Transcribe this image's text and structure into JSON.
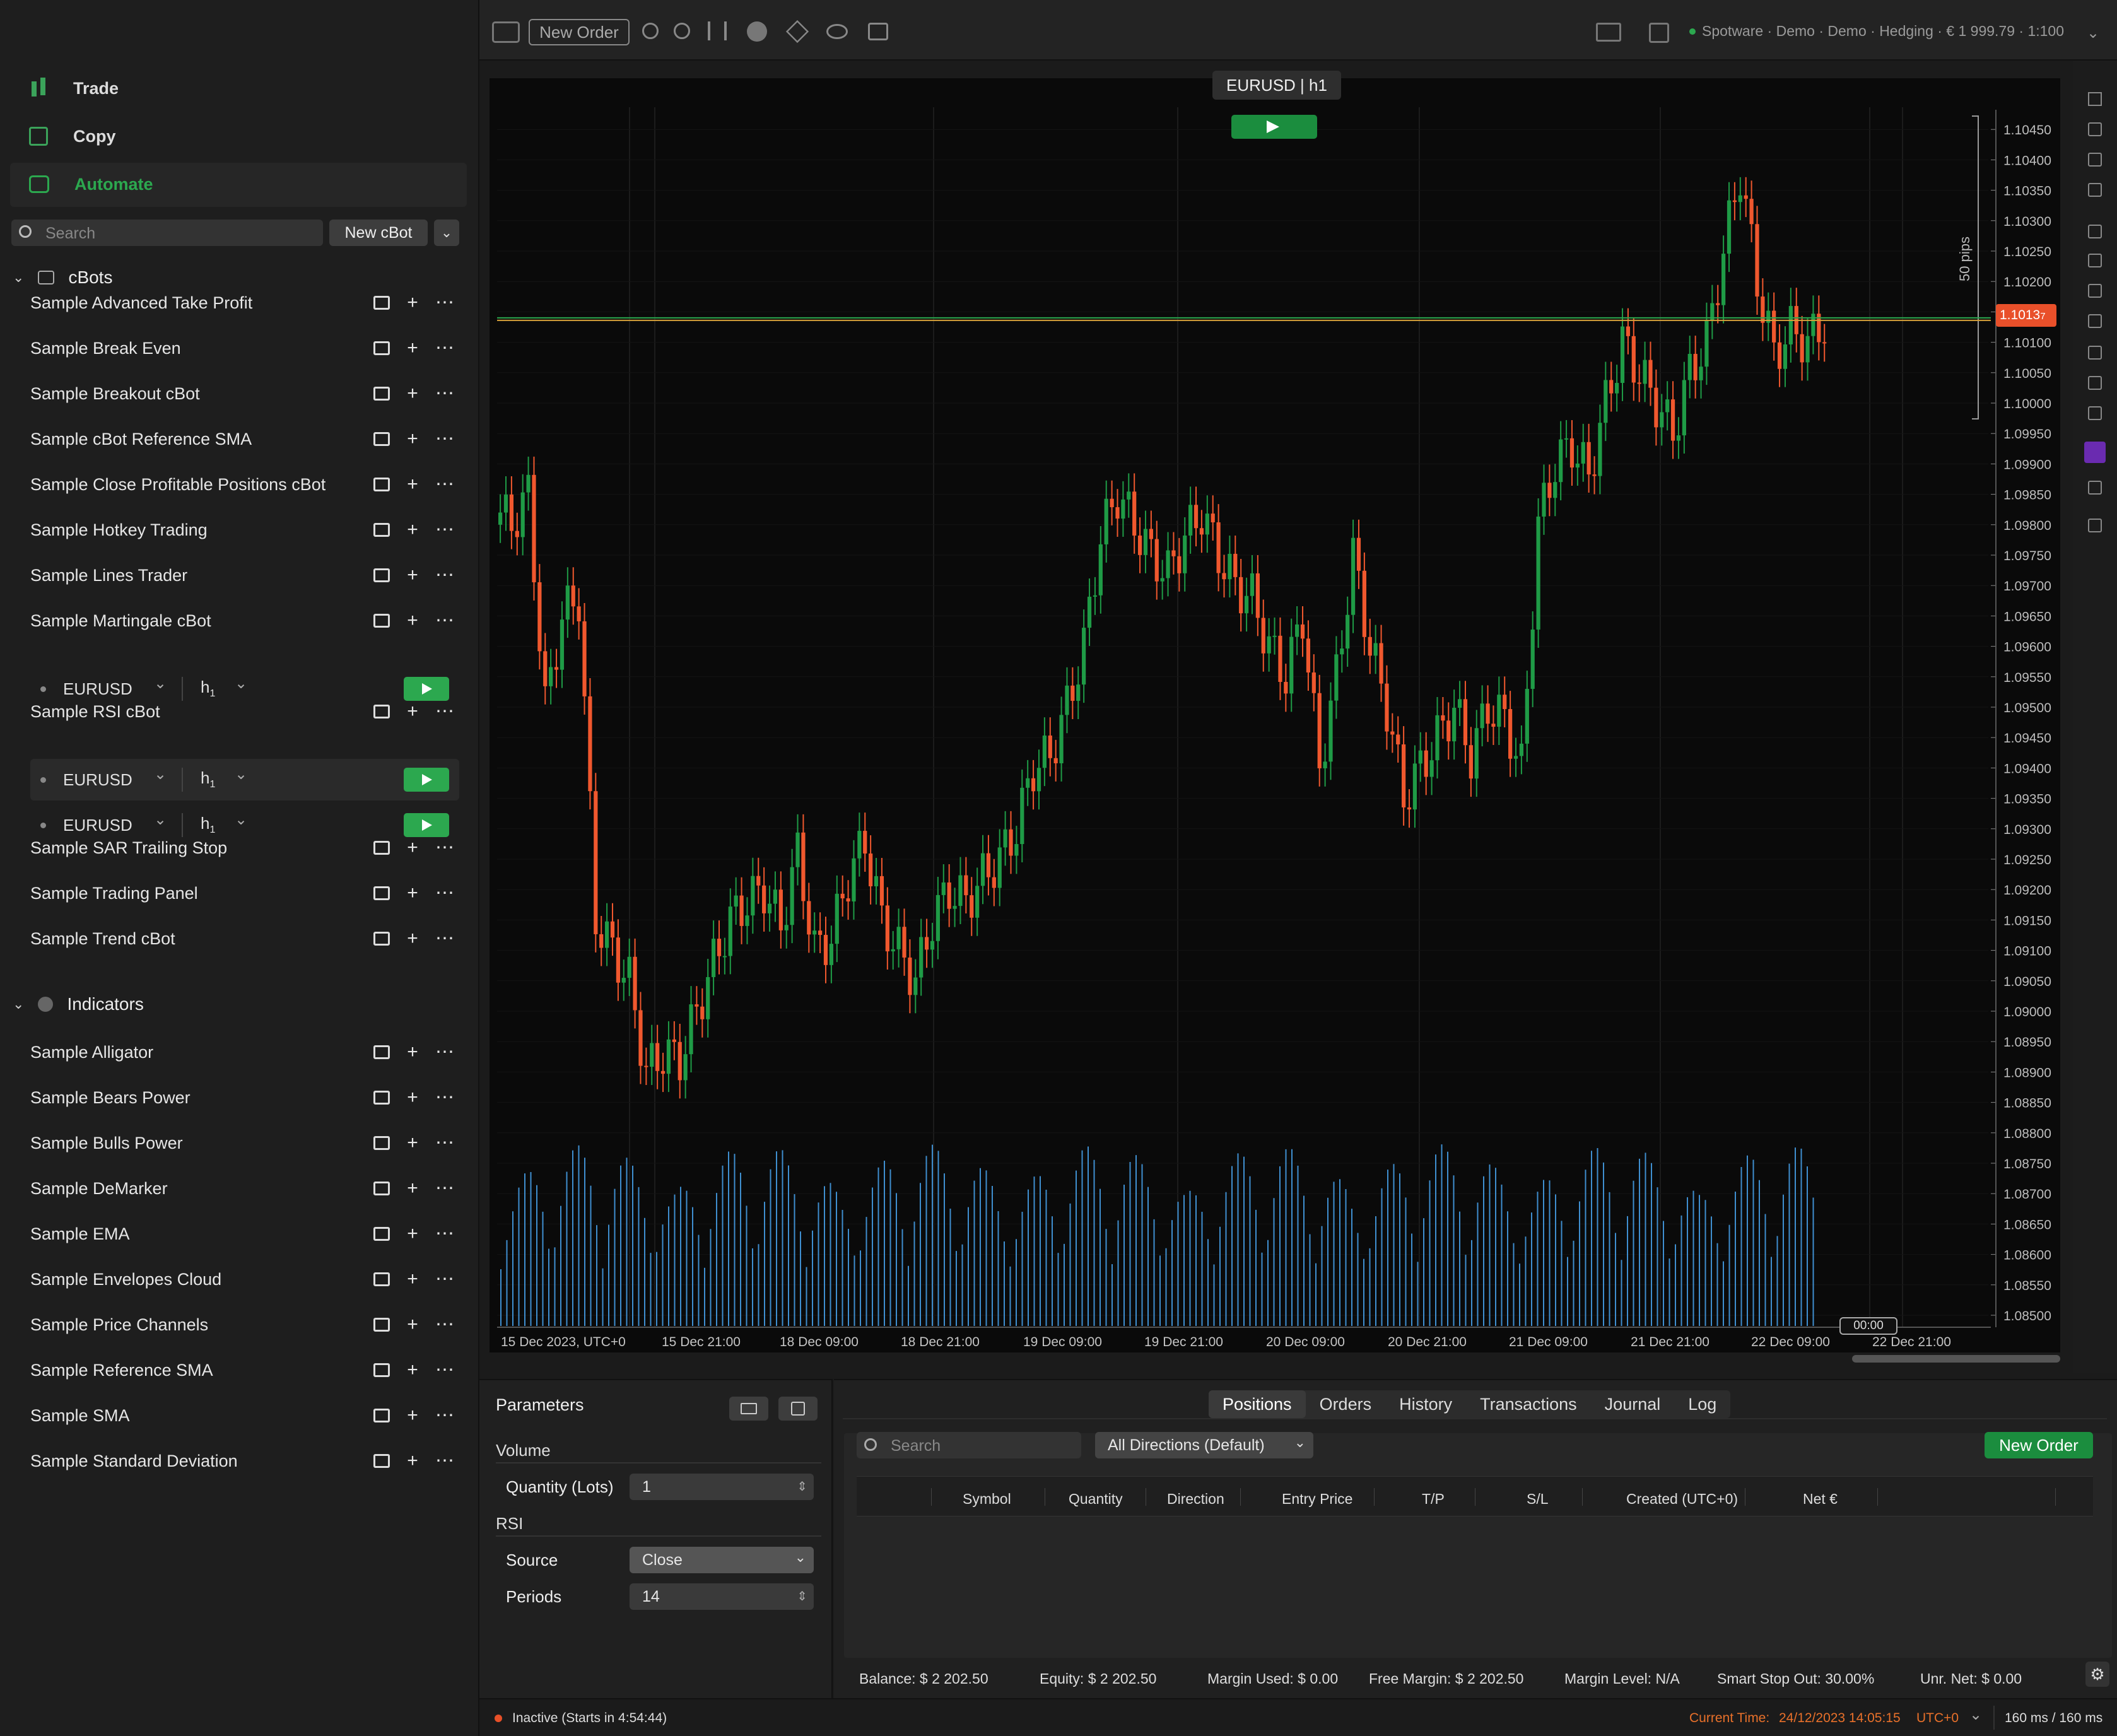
{
  "nav": [
    {
      "label": "Trade",
      "active": false
    },
    {
      "label": "Copy",
      "active": false
    },
    {
      "label": "Automate",
      "active": true
    }
  ],
  "sidebar": {
    "search_placeholder": "Search",
    "new_cbot_label": "New cBot",
    "cbots_section": "cBots",
    "indicators_section": "Indicators",
    "cbots": [
      "Sample Advanced Take Profit",
      "Sample Break Even",
      "Sample Breakout cBot",
      "Sample cBot Reference SMA",
      "Sample Close Profitable Positions cBot",
      "Sample Hotkey Trading",
      "Sample Lines Trader",
      "Sample Martingale cBot",
      "Sample RSI cBot",
      "Sample SAR Trailing Stop",
      "Sample Trading Panel",
      "Sample Trend cBot"
    ],
    "instances": [
      {
        "symbol": "EURUSD",
        "timeframe": "h",
        "tf_sub": "1"
      },
      {
        "symbol": "EURUSD",
        "timeframe": "h",
        "tf_sub": "1"
      },
      {
        "symbol": "EURUSD",
        "timeframe": "h",
        "tf_sub": "1"
      }
    ],
    "indicators": [
      "Sample Alligator",
      "Sample Bears Power",
      "Sample Bulls Power",
      "Sample DeMarker",
      "Sample EMA",
      "Sample Envelopes Cloud",
      "Sample Price Channels",
      "Sample Reference SMA",
      "Sample SMA",
      "Sample Standard Deviation"
    ]
  },
  "toolbar": {
    "new_order_label": "New Order",
    "account_info": "Spotware · Demo · Demo · Hedging · € 1 999.79 · 1:100"
  },
  "chart": {
    "title": "EURUSD | h1",
    "pips_label": "50 pips",
    "current_price": "1.1013",
    "current_price_sub": "7",
    "price_ticks": [
      "1.1045",
      "1.1040",
      "1.1035",
      "1.1030",
      "1.1025",
      "1.1020",
      "1.1015",
      "1.1010",
      "1.1005",
      "1.1000",
      "1.0995",
      "1.0990",
      "1.0985",
      "1.0980",
      "1.0975",
      "1.0970",
      "1.0965",
      "1.0960",
      "1.0955",
      "1.0950",
      "1.0945",
      "1.0940",
      "1.0935",
      "1.0930",
      "1.0925",
      "1.0920",
      "1.0915",
      "1.0910",
      "1.0905",
      "1.0900",
      "1.0895",
      "1.0890",
      "1.0885",
      "1.0880",
      "1.0875",
      "1.0870",
      "1.0865",
      "1.0860",
      "1.0855",
      "1.0850"
    ],
    "tick_suffix": "0",
    "time_labels": [
      "15 Dec 2023, UTC+0",
      "15 Dec 21:00",
      "18 Dec 09:00",
      "18 Dec 21:00",
      "19 Dec 09:00",
      "19 Dec 21:00",
      "20 Dec 09:00",
      "20 Dec 21:00",
      "21 Dec 09:00",
      "21 Dec 21:00",
      "22 Dec 09:00",
      "22 Dec 21:00"
    ],
    "cursor_time": "00:00"
  },
  "chart_data": {
    "type": "candlestick",
    "symbol": "EURUSD",
    "timeframe": "h1",
    "ylim": [
      1.0848,
      1.1048
    ],
    "current_price": 1.10137,
    "close": [
      1.098,
      1.0985,
      1.095,
      1.0965,
      1.0968,
      1.0915,
      1.091,
      1.0905,
      1.089,
      1.0893,
      1.0892,
      1.09,
      1.0908,
      1.0915,
      1.0918,
      1.092,
      1.0914,
      1.0926,
      1.091,
      1.0912,
      1.0922,
      1.0928,
      1.0915,
      1.091,
      1.0905,
      1.0915,
      1.092,
      1.0918,
      1.0922,
      1.0925,
      1.093,
      1.094,
      1.0942,
      1.095,
      1.096,
      1.0978,
      1.0985,
      1.098,
      1.0975,
      1.0972,
      1.0978,
      1.0982,
      1.0975,
      1.097,
      1.0968,
      1.096,
      1.0955,
      1.0965,
      1.094,
      1.0955,
      1.0975,
      1.096,
      1.095,
      1.0935,
      1.094,
      1.0945,
      1.095,
      1.0942,
      1.095,
      1.0948,
      1.094,
      1.098,
      1.099,
      1.0993,
      1.0988,
      1.1,
      1.101,
      1.1005,
      1.1,
      1.0995,
      1.1005,
      1.101,
      1.1025,
      1.1038,
      1.102,
      1.1008,
      1.1012,
      1.101,
      1.1013
    ],
    "volume_scale": "relative"
  },
  "params": {
    "title": "Parameters",
    "group_volume": "Volume",
    "quantity_label": "Quantity (Lots)",
    "quantity_value": "1",
    "group_rsi": "RSI",
    "source_label": "Source",
    "source_value": "Close",
    "periods_label": "Periods",
    "periods_value": "14"
  },
  "trade_panel": {
    "tabs": [
      "Positions",
      "Orders",
      "History",
      "Transactions",
      "Journal",
      "Log"
    ],
    "active_tab": "Positions",
    "search_placeholder": "Search",
    "direction_filter": "All Directions (Default)",
    "new_order_label": "New Order",
    "columns": [
      "Symbol",
      "Quantity",
      "Direction",
      "Entry Price",
      "T/P",
      "S/L",
      "Created (UTC+0)",
      "Net €"
    ],
    "footer": [
      {
        "label": "Balance:",
        "value": "$ 2 202.50"
      },
      {
        "label": "Equity:",
        "value": "$ 2 202.50"
      },
      {
        "label": "Margin Used:",
        "value": "$ 0.00"
      },
      {
        "label": "Free Margin:",
        "value": "$ 2 202.50"
      },
      {
        "label": "Margin Level:",
        "value": "N/A"
      },
      {
        "label": "Smart Stop Out:",
        "value": "30.00%"
      },
      {
        "label": "Unr. Net:",
        "value": "$ 0.00"
      }
    ]
  },
  "status": {
    "state": "Inactive (Starts in 4:54:44)",
    "current_time_label": "Current Time:",
    "current_time": "24/12/2023 14:05:15",
    "timezone": "UTC+0",
    "latency": "160 ms / 160 ms"
  },
  "colors": {
    "bull": "#1f9b46",
    "bear": "#f0582e",
    "volume": "#3f8fd0",
    "accent": "#2ca84f"
  }
}
